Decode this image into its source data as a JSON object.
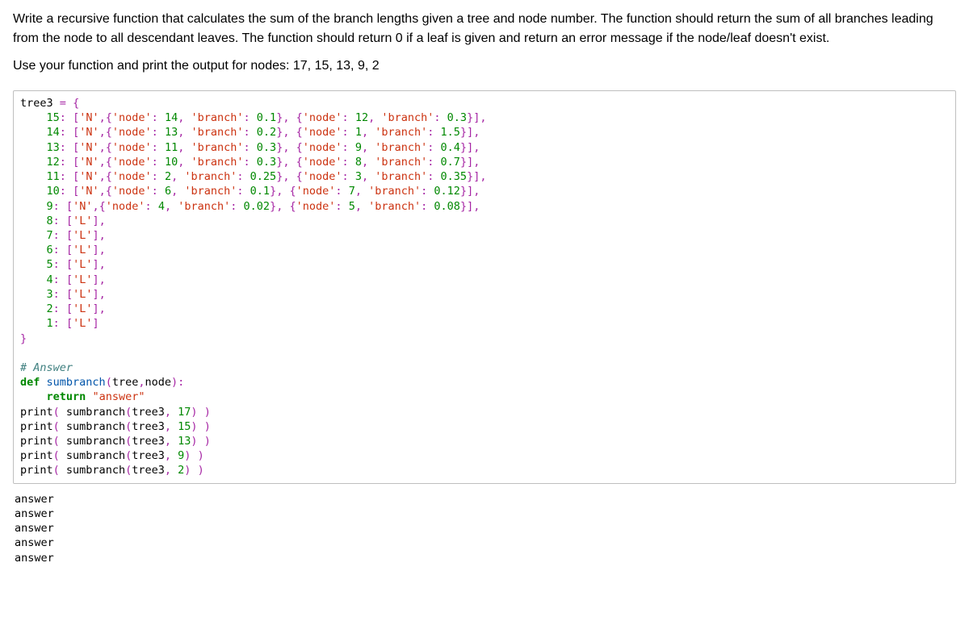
{
  "prompt": {
    "p1": "Write a recursive function that calculates the sum of the branch lengths given a tree and node number. The function should return the sum of all branches leading from the node to all descendant leaves. The function should return 0 if a leaf is given and return an error message if the node/leaf doesn't exist.",
    "p2": "Use your function and print the output for nodes: 17, 15, 13, 9, 2"
  },
  "tree_data": {
    "15": [
      "N",
      {
        "node": 14,
        "branch": 0.1
      },
      {
        "node": 12,
        "branch": 0.3
      }
    ],
    "14": [
      "N",
      {
        "node": 13,
        "branch": 0.2
      },
      {
        "node": 1,
        "branch": 1.5
      }
    ],
    "13": [
      "N",
      {
        "node": 11,
        "branch": 0.3
      },
      {
        "node": 9,
        "branch": 0.4
      }
    ],
    "12": [
      "N",
      {
        "node": 10,
        "branch": 0.3
      },
      {
        "node": 8,
        "branch": 0.7
      }
    ],
    "11": [
      "N",
      {
        "node": 2,
        "branch": 0.25
      },
      {
        "node": 3,
        "branch": 0.35
      }
    ],
    "10": [
      "N",
      {
        "node": 6,
        "branch": 0.1
      },
      {
        "node": 7,
        "branch": 0.12
      }
    ],
    "9": [
      "N",
      {
        "node": 4,
        "branch": 0.02
      },
      {
        "node": 5,
        "branch": 0.08
      }
    ],
    "8": [
      "L"
    ],
    "7": [
      "L"
    ],
    "6": [
      "L"
    ],
    "5": [
      "L"
    ],
    "4": [
      "L"
    ],
    "3": [
      "L"
    ],
    "2": [
      "L"
    ],
    "1": [
      "L"
    ]
  },
  "code": {
    "assign": "tree3 = {",
    "lines": [
      "    15: ['N',{'node': 14, 'branch': 0.1}, {'node': 12, 'branch': 0.3}],",
      "    14: ['N',{'node': 13, 'branch': 0.2}, {'node': 1, 'branch': 1.5}],",
      "    13: ['N',{'node': 11, 'branch': 0.3}, {'node': 9, 'branch': 0.4}],",
      "    12: ['N',{'node': 10, 'branch': 0.3}, {'node': 8, 'branch': 0.7}],",
      "    11: ['N',{'node': 2, 'branch': 0.25}, {'node': 3, 'branch': 0.35}],",
      "    10: ['N',{'node': 6, 'branch': 0.1}, {'node': 7, 'branch': 0.12}],",
      "    9: ['N',{'node': 4, 'branch': 0.02}, {'node': 5, 'branch': 0.08}],",
      "    8: ['L'],",
      "    7: ['L'],",
      "    6: ['L'],",
      "    5: ['L'],",
      "    4: ['L'],",
      "    3: ['L'],",
      "    2: ['L'],",
      "    1: ['L']"
    ],
    "close": "}",
    "comment": "# Answer",
    "defline": "def sumbranch(tree,node):",
    "retline": "    return \"answer\"",
    "prints": [
      "print( sumbranch(tree3, 17) )",
      "print( sumbranch(tree3, 15) )",
      "print( sumbranch(tree3, 13) )",
      "print( sumbranch(tree3, 9) )",
      "print( sumbranch(tree3, 2) )"
    ]
  },
  "output_lines": [
    "answer",
    "answer",
    "answer",
    "answer",
    "answer"
  ]
}
